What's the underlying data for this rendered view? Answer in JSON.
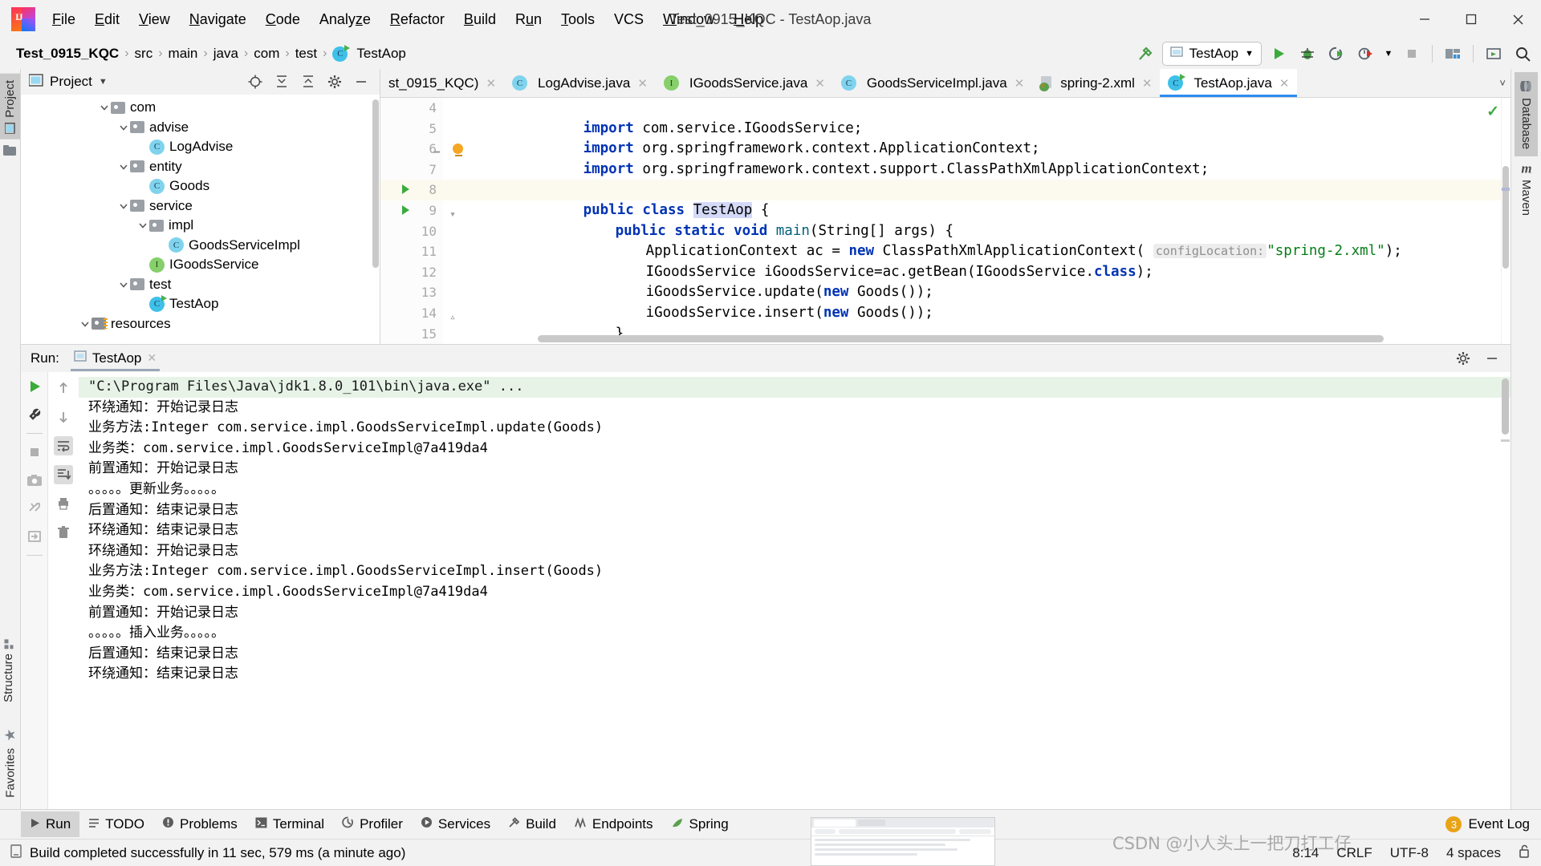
{
  "window": {
    "title": "Test_0915_KQC - TestAop.java",
    "logo_name": "intellij-idea-logo",
    "minimize_label": "Minimize",
    "maximize_label": "Maximize",
    "close_label": "Close"
  },
  "menu": [
    {
      "label": "File",
      "mnemonic": "F"
    },
    {
      "label": "Edit",
      "mnemonic": "E"
    },
    {
      "label": "View",
      "mnemonic": "V"
    },
    {
      "label": "Navigate",
      "mnemonic": "N"
    },
    {
      "label": "Code",
      "mnemonic": "C"
    },
    {
      "label": "Analyze",
      "mnemonic": "z"
    },
    {
      "label": "Refactor",
      "mnemonic": "R"
    },
    {
      "label": "Build",
      "mnemonic": "B"
    },
    {
      "label": "Run",
      "mnemonic": "R"
    },
    {
      "label": "Tools",
      "mnemonic": "T"
    },
    {
      "label": "VCS",
      "mnemonic": ""
    },
    {
      "label": "Window",
      "mnemonic": "W"
    },
    {
      "label": "Help",
      "mnemonic": "H"
    }
  ],
  "breadcrumb": {
    "items": [
      "Test_0915_KQC",
      "src",
      "main",
      "java",
      "com",
      "test",
      "TestAop"
    ],
    "separator": "›"
  },
  "toolbar": {
    "build_icon": "hammer-icon",
    "run_config_name": "TestAop",
    "run_label": "Run",
    "debug_label": "Debug",
    "run_coverage_label": "Run with Coverage",
    "profiler_label": "Profiler",
    "stop_label": "Stop",
    "settings_label": "Project Structure",
    "updates_label": "Updates",
    "search_label": "Search Everywhere"
  },
  "project_panel": {
    "title": "Project",
    "dropdown_icon": "chevron-down-icon",
    "actions": [
      "locate-icon",
      "expand-all-icon",
      "collapse-all-icon",
      "settings-gear-icon",
      "hide-icon"
    ],
    "tree": [
      {
        "label": "com",
        "indent": 4,
        "type": "folder",
        "expanded": true
      },
      {
        "label": "advise",
        "indent": 5,
        "type": "folder",
        "expanded": true
      },
      {
        "label": "LogAdvise",
        "indent": 6,
        "type": "class"
      },
      {
        "label": "entity",
        "indent": 5,
        "type": "folder",
        "expanded": true
      },
      {
        "label": "Goods",
        "indent": 6,
        "type": "class"
      },
      {
        "label": "service",
        "indent": 5,
        "type": "folder",
        "expanded": true
      },
      {
        "label": "impl",
        "indent": 6,
        "type": "folder",
        "expanded": true
      },
      {
        "label": "GoodsServiceImpl",
        "indent": 7,
        "type": "class"
      },
      {
        "label": "IGoodsService",
        "indent": 6,
        "type": "interface"
      },
      {
        "label": "test",
        "indent": 5,
        "type": "folder",
        "expanded": true
      },
      {
        "label": "TestAop",
        "indent": 6,
        "type": "runnable-class"
      },
      {
        "label": "resources",
        "indent": 3,
        "type": "resource-folder",
        "expanded": true
      }
    ]
  },
  "editor": {
    "tabs": [
      {
        "label": "st_0915_KQC)",
        "icon": "none",
        "active": false
      },
      {
        "label": "LogAdvise.java",
        "icon": "class",
        "active": false
      },
      {
        "label": "IGoodsService.java",
        "icon": "interface",
        "active": false
      },
      {
        "label": "GoodsServiceImpl.java",
        "icon": "class",
        "active": false
      },
      {
        "label": "spring-2.xml",
        "icon": "spring-xml",
        "active": false
      },
      {
        "label": "TestAop.java",
        "icon": "runnable-class",
        "active": true
      }
    ],
    "tab_overflow_icon": "chevron-down-icon",
    "inspection_status": "ok-check-icon",
    "lines": [
      {
        "num": "4",
        "indent": 0,
        "gutter": "",
        "current": false
      },
      {
        "num": "5",
        "indent": 0,
        "gutter": "",
        "current": false
      },
      {
        "num": "6",
        "indent": 0,
        "gutter": "fold",
        "current": false
      },
      {
        "num": "7",
        "indent": 0,
        "gutter": "bulb",
        "current": false
      },
      {
        "num": "8",
        "indent": 0,
        "gutter": "run",
        "current": true
      },
      {
        "num": "9",
        "indent": 1,
        "gutter": "run",
        "current": false
      },
      {
        "num": "10",
        "indent": 2,
        "gutter": "",
        "current": false
      },
      {
        "num": "11",
        "indent": 2,
        "gutter": "",
        "current": false
      },
      {
        "num": "12",
        "indent": 2,
        "gutter": "",
        "current": false
      },
      {
        "num": "13",
        "indent": 2,
        "gutter": "",
        "current": false
      },
      {
        "num": "14",
        "indent": 1,
        "gutter": "fold",
        "current": false
      },
      {
        "num": "15",
        "indent": 0,
        "gutter": "",
        "current": false
      }
    ],
    "code": {
      "l4_kw": "import",
      "l4_rest": " com.service.IGoodsService;",
      "l5_kw": "import",
      "l5_rest": " org.springframework.context.ApplicationContext;",
      "l6_kw": "import",
      "l6_rest": " org.springframework.context.support.ClassPathXmlApplicationContext;",
      "l8_a": "public ",
      "l8_b": "class ",
      "l8_c": "TestAop",
      "l8_d": " {",
      "l9_a": "public static void ",
      "l9_b": "main",
      "l9_c": "(String[] args) {",
      "l10_a": "ApplicationContext ac = ",
      "l10_b": "new",
      "l10_c": " ClassPathXmlApplicationContext( ",
      "l10_hint": "configLocation:",
      "l10_str": "\"spring-2.xml\"",
      "l10_end": ");",
      "l11_a": "IGoodsService iGoodsService=ac.getBean(IGoodsService.",
      "l11_b": "class",
      "l11_c": ");",
      "l12_a": "iGoodsService.update(",
      "l12_b": "new",
      "l12_c": " Goods());",
      "l13_a": "iGoodsService.insert(",
      "l13_b": "new",
      "l13_c": " Goods());",
      "l14": "}",
      "l15": "}"
    }
  },
  "run_panel": {
    "label": "Run:",
    "tab_name": "TestAop",
    "tab_icon": "run-configuration-icon",
    "close_icon": "close-icon",
    "settings_icon": "gear-icon",
    "hide_icon": "minimize-icon",
    "left_buttons": [
      "rerun-icon",
      "edit-configuration-icon",
      "stop-icon",
      "screenshot-icon",
      "dump-threads-icon",
      "export-icon"
    ],
    "right_buttons": [
      "up-arrow-icon",
      "down-arrow-icon",
      "soft-wrap-icon",
      "scroll-to-end-icon",
      "print-icon",
      "trash-icon"
    ],
    "output": [
      {
        "text": "\"C:\\Program Files\\Java\\jdk1.8.0_101\\bin\\java.exe\" ...",
        "style": "cmd"
      },
      {
        "text": "环绕通知：开始记录日志",
        "style": "zh"
      },
      {
        "text": "业务方法:Integer com.service.impl.GoodsServiceImpl.update(Goods)",
        "style": "plain"
      },
      {
        "text": "业务类：com.service.impl.GoodsServiceImpl@7a419da4",
        "style": "plain"
      },
      {
        "text": "前置通知：开始记录日志",
        "style": "zh"
      },
      {
        "text": "。。。。。更新业务。。。。。",
        "style": "zh"
      },
      {
        "text": "后置通知：结束记录日志",
        "style": "zh"
      },
      {
        "text": "环绕通知：结束记录日志",
        "style": "zh"
      },
      {
        "text": "环绕通知：开始记录日志",
        "style": "zh"
      },
      {
        "text": "业务方法:Integer com.service.impl.GoodsServiceImpl.insert(Goods)",
        "style": "plain"
      },
      {
        "text": "业务类：com.service.impl.GoodsServiceImpl@7a419da4",
        "style": "plain"
      },
      {
        "text": "前置通知：开始记录日志",
        "style": "zh"
      },
      {
        "text": "。。。。。插入业务。。。。。",
        "style": "zh"
      },
      {
        "text": "后置通知：结束记录日志",
        "style": "zh"
      },
      {
        "text": "环绕通知：结束记录日志",
        "style": "zh"
      }
    ]
  },
  "left_strip": {
    "top": [
      {
        "label": "Project",
        "icon": "project-icon",
        "active": true
      }
    ],
    "bottom": [
      {
        "label": "Structure",
        "icon": "structure-icon",
        "active": false
      },
      {
        "label": "Favorites",
        "icon": "star-icon",
        "active": false
      }
    ]
  },
  "right_strip": [
    {
      "label": "Database",
      "icon": "database-icon",
      "active": true
    },
    {
      "label": "Maven",
      "icon": "maven-m-icon",
      "active": false
    }
  ],
  "bottom_bar": {
    "items": [
      {
        "label": "Run",
        "icon": "play-icon",
        "active": true
      },
      {
        "label": "TODO",
        "icon": "todo-list-icon",
        "active": false
      },
      {
        "label": "Problems",
        "icon": "problems-icon",
        "active": false
      },
      {
        "label": "Terminal",
        "icon": "terminal-icon",
        "active": false
      },
      {
        "label": "Profiler",
        "icon": "profiler-icon",
        "active": false
      },
      {
        "label": "Services",
        "icon": "services-icon",
        "active": false
      },
      {
        "label": "Build",
        "icon": "hammer-icon",
        "active": false
      },
      {
        "label": "Endpoints",
        "icon": "endpoints-icon",
        "active": false
      },
      {
        "label": "Spring",
        "icon": "spring-leaf-icon",
        "active": false
      }
    ],
    "event_log_label": "Event Log",
    "event_log_count": "3"
  },
  "status_bar": {
    "message": "Build completed successfully in 11 sec, 579 ms (a minute ago)",
    "message_icon": "notification-icon",
    "caret_position": "8:14",
    "line_separator": "CRLF",
    "encoding": "UTF-8",
    "indent": "4 spaces",
    "lock_icon": "unlocked-icon",
    "watermark": "CSDN @小人头上一把刀打工仔"
  },
  "colors": {
    "accent_blue": "#2d8cf0",
    "keyword": "#0033b3",
    "string": "#067d17",
    "method": "#00627a",
    "green_run": "#3cab3c",
    "current_line": "#fcfaef",
    "console_cmd_bg": "#e7f3e7"
  }
}
